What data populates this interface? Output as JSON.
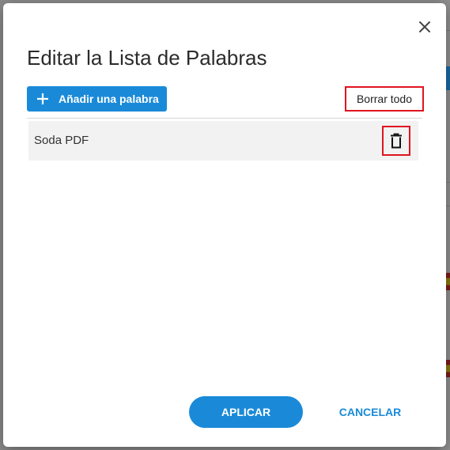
{
  "dialog": {
    "title": "Editar la Lista de Palabras",
    "add_word_label": "Añadir una palabra",
    "clear_all_label": "Borrar todo",
    "words": [
      {
        "text": "Soda PDF"
      }
    ],
    "apply_label": "APLICAR",
    "cancel_label": "CANCELAR"
  },
  "icons": {
    "close": "close-icon",
    "add": "plus-icon",
    "delete": "trash-icon"
  },
  "colors": {
    "accent": "#1a8ad8",
    "highlight_border": "#e0141e",
    "row_background": "#f2f2f2"
  }
}
